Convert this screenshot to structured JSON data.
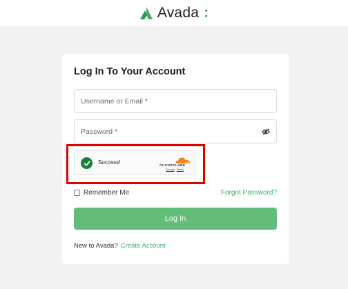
{
  "brand": {
    "name": "Avada",
    "colon": ":",
    "logo_icon": "avada-logo-icon",
    "accent": "#3fae6a"
  },
  "login": {
    "title": "Log In To Your Account",
    "username_placeholder": "Username or Email *",
    "password_placeholder": "Password *",
    "password_toggle_icon": "eye-icon",
    "captcha": {
      "status": "Success!",
      "provider": "CLOUDFLARE",
      "privacy": "Privacy",
      "separator": " • ",
      "terms": "Terms"
    },
    "remember_label": "Remember Me",
    "forgot_label": "Forgot Password?",
    "submit_label": "Log In",
    "signup_prompt": "New to Avada?",
    "signup_link": "Create Account"
  },
  "colors": {
    "button": "#62bd7a",
    "highlight": "#e00000",
    "check": "#1a7f37"
  }
}
